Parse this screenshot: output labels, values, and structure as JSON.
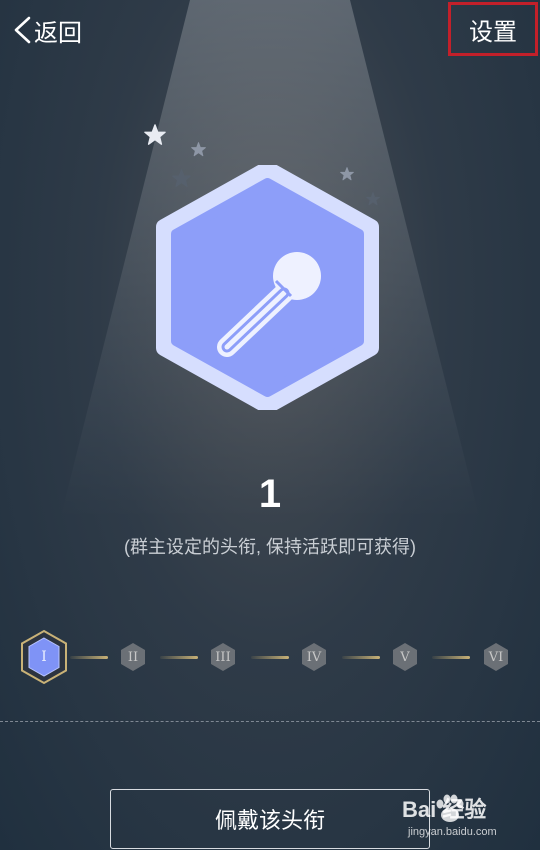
{
  "header": {
    "back_label": "返回",
    "settings_label": "设置"
  },
  "badge": {
    "icon": "microphone-icon",
    "color": "#8d9ef9"
  },
  "title_level": {
    "number": "1",
    "description": "(群主设定的头衔, 保持活跃即可获得)"
  },
  "levels": {
    "current": 1,
    "items": [
      "I",
      "II",
      "III",
      "IV",
      "V",
      "VI"
    ]
  },
  "actions": {
    "wear_label": "佩戴该头衔"
  },
  "watermark": {
    "text": "Bai 经验",
    "sub": "jingyan.baidu.com"
  }
}
